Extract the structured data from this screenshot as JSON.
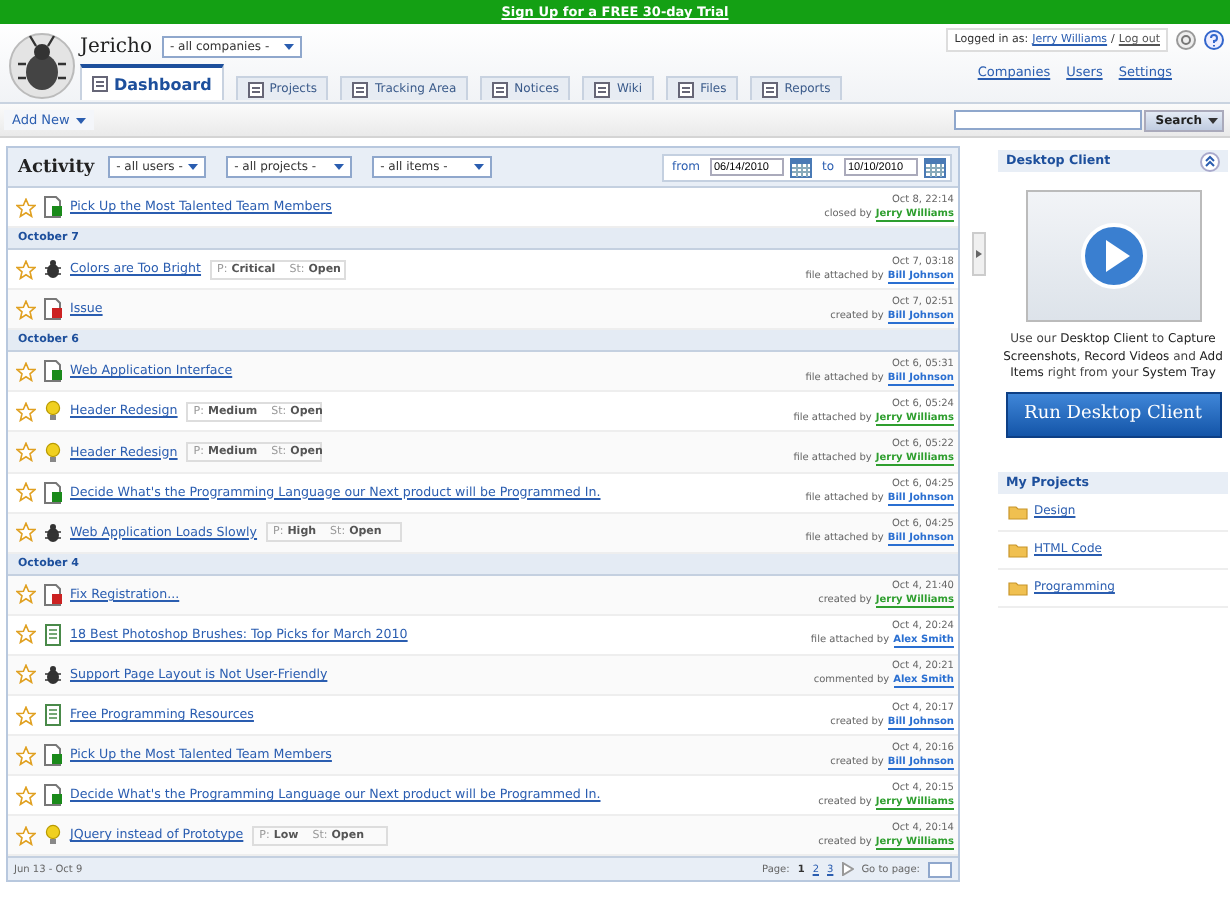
{
  "promo_bar": {
    "text": "Sign Up for a FREE 30-day Trial"
  },
  "header": {
    "app_name": "Jericho",
    "company_select": "- all companies -",
    "tabs": [
      {
        "label": "Dashboard",
        "selected": true
      },
      {
        "label": "Projects",
        "selected": false
      },
      {
        "label": "Tracking Area",
        "selected": false
      },
      {
        "label": "Notices",
        "selected": false
      },
      {
        "label": "Wiki",
        "selected": false
      },
      {
        "label": "Files",
        "selected": false
      },
      {
        "label": "Reports",
        "selected": false
      }
    ],
    "login": {
      "prefix": "Logged in as:",
      "user": "Jerry Williams",
      "separator": "/",
      "logout": "Log out"
    },
    "links": [
      "Companies",
      "Users",
      "Settings"
    ]
  },
  "toolbar": {
    "add_new": "Add New",
    "search_button": "Search"
  },
  "activity": {
    "title": "Activity",
    "filters": [
      "- all users -",
      "- all projects -",
      "- all items -"
    ],
    "from_label": "from",
    "from": "06/14/2010",
    "to_label": "to",
    "to": "10/10/2010",
    "entries": [
      {
        "kind": "task",
        "starred": false,
        "title": "Pick Up the Most Talented Team Members",
        "time": "Oct 8, 22:14",
        "action": "closed by",
        "user": {
          "name": "Jerry Williams",
          "color": "#2e9e2e"
        }
      },
      {
        "kind": "date",
        "label": "October 7"
      },
      {
        "kind": "bug",
        "starred": false,
        "title": "Colors are Too Bright",
        "priority_label": "P:",
        "priority": "Critical",
        "status_label": "St:",
        "status": "Open",
        "time": "Oct 7, 03:18",
        "action": "file attached by",
        "user": {
          "name": "Bill Johnson",
          "color": "#2a6fd1"
        }
      },
      {
        "kind": "issue",
        "starred": false,
        "title": "Issue",
        "time": "Oct 7, 02:51",
        "action": "created by",
        "user": {
          "name": "Bill Johnson",
          "color": "#2a6fd1"
        }
      },
      {
        "kind": "date",
        "label": "October 6"
      },
      {
        "kind": "task",
        "starred": false,
        "title": "Web Application Interface",
        "time": "Oct 6, 05:31",
        "action": "file attached by",
        "user": {
          "name": "Bill Johnson",
          "color": "#2a6fd1"
        }
      },
      {
        "kind": "idea",
        "starred": false,
        "title": "Header Redesign",
        "priority_label": "P:",
        "priority": "Medium",
        "status_label": "St:",
        "status": "Open",
        "time": "Oct 6, 05:24",
        "action": "file attached by",
        "user": {
          "name": "Jerry Williams",
          "color": "#2e9e2e"
        }
      },
      {
        "kind": "idea",
        "starred": false,
        "title": "Header Redesign",
        "priority_label": "P:",
        "priority": "Medium",
        "status_label": "St:",
        "status": "Open",
        "time": "Oct 6, 05:22",
        "action": "file attached by",
        "user": {
          "name": "Jerry Williams",
          "color": "#2e9e2e"
        }
      },
      {
        "kind": "task",
        "starred": false,
        "title": "Decide What's the Programming Language our Next product will be Programmed In.",
        "time": "Oct 6, 04:25",
        "action": "file attached by",
        "user": {
          "name": "Bill Johnson",
          "color": "#2a6fd1"
        }
      },
      {
        "kind": "bug",
        "starred": false,
        "title": "Web Application Loads Slowly",
        "priority_label": "P:",
        "priority": "High",
        "status_label": "St:",
        "status": "Open",
        "time": "Oct 6, 04:25",
        "action": "file attached by",
        "user": {
          "name": "Bill Johnson",
          "color": "#2a6fd1"
        }
      },
      {
        "kind": "date",
        "label": "October 4"
      },
      {
        "kind": "issue",
        "starred": false,
        "title": "Fix Registration...",
        "time": "Oct 4, 21:40",
        "action": "created by",
        "user": {
          "name": "Jerry Williams",
          "color": "#2e9e2e"
        }
      },
      {
        "kind": "document",
        "starred": false,
        "title": "18 Best Photoshop Brushes: Top Picks for March 2010",
        "time": "Oct 4, 20:24",
        "action": "file attached by",
        "user": {
          "name": "Alex Smith",
          "color": "#2a6fd1"
        }
      },
      {
        "kind": "bug",
        "starred": false,
        "title": "Support Page Layout is Not User-Friendly",
        "time": "Oct 4, 20:21",
        "action": "commented by",
        "user": {
          "name": "Alex Smith",
          "color": "#2a6fd1"
        }
      },
      {
        "kind": "document",
        "starred": false,
        "title": "Free Programming Resources",
        "time": "Oct 4, 20:17",
        "action": "created by",
        "user": {
          "name": "Bill Johnson",
          "color": "#2a6fd1"
        }
      },
      {
        "kind": "task",
        "starred": false,
        "title": "Pick Up the Most Talented Team Members",
        "time": "Oct 4, 20:16",
        "action": "created by",
        "user": {
          "name": "Bill Johnson",
          "color": "#2a6fd1"
        }
      },
      {
        "kind": "task",
        "starred": false,
        "title": "Decide What's the Programming Language our Next product will be Programmed In.",
        "time": "Oct 4, 20:15",
        "action": "created by",
        "user": {
          "name": "Jerry Williams",
          "color": "#2e9e2e"
        }
      },
      {
        "kind": "idea",
        "starred": false,
        "title": "JQuery instead of Prototype",
        "priority_label": "P:",
        "priority": "Low",
        "status_label": "St:",
        "status": "Open",
        "time": "Oct 4, 20:14",
        "action": "created by",
        "user": {
          "name": "Jerry Williams",
          "color": "#2e9e2e"
        }
      }
    ],
    "footer": {
      "range": "Jun 13 - Oct 9",
      "page_label": "Page:",
      "pages": [
        {
          "label": "1",
          "selected": true
        },
        {
          "label": "2",
          "selected": false
        },
        {
          "label": "3",
          "selected": false
        }
      ],
      "goto_label": "Go to page:"
    }
  },
  "sidebar": {
    "desktop_client": {
      "title": "Desktop Client",
      "description": "Use our **Desktop Client** to **Capture Screenshots**, **Record Videos** and **Add Items** right from your **System Tray**",
      "button": "Run Desktop Client"
    },
    "my_projects": {
      "title": "My Projects",
      "projects": [
        "Design",
        "HTML Code",
        "Programming"
      ]
    }
  }
}
